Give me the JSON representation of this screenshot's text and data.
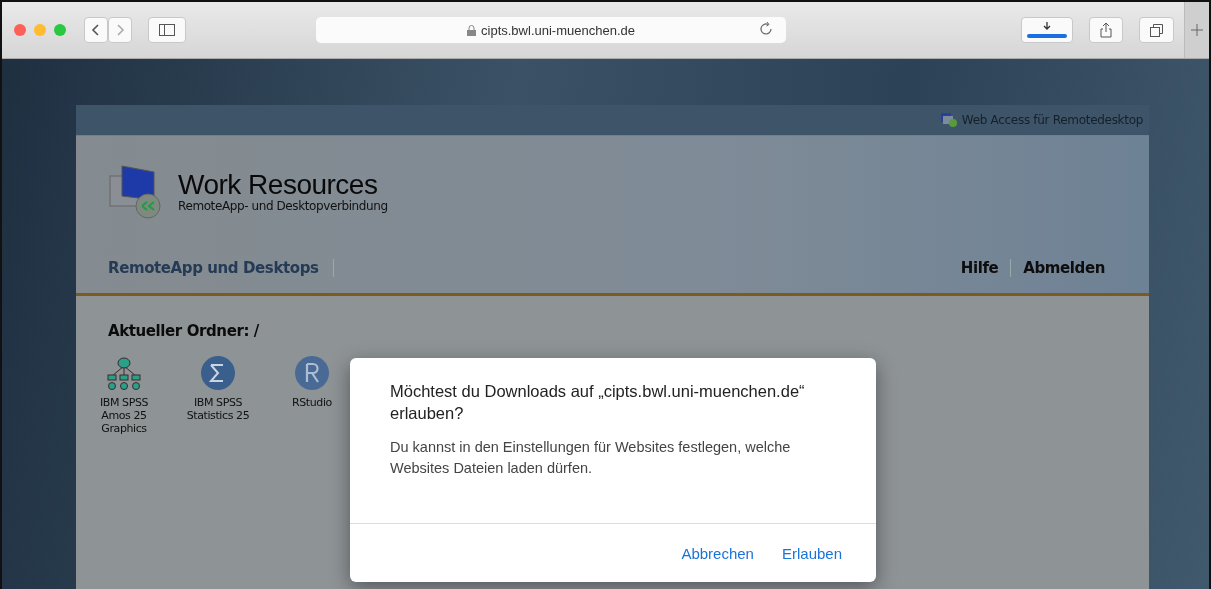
{
  "toolbar": {
    "url": "cipts.bwl.uni-muenchen.de"
  },
  "page": {
    "top_link": "Web Access für Remotedesktop",
    "title": "Work Resources",
    "subtitle": "RemoteApp- und Desktopverbindung",
    "nav_tabs": [
      {
        "label": "RemoteApp und Desktops",
        "selected": true
      }
    ],
    "nav_links": [
      "Hilfe",
      "Abmelden"
    ],
    "folder_label": "Aktueller Ordner: /",
    "apps": [
      {
        "kind": "amos",
        "label": "IBM SPSS Amos 25 Graphics"
      },
      {
        "kind": "spss",
        "label": "IBM SPSS Statistics 25"
      },
      {
        "kind": "r",
        "label": "RStudio"
      }
    ]
  },
  "dialog": {
    "title": "Möchtest du Downloads auf „cipts.bwl.uni-muenchen.de“ erlauben?",
    "message": "Du kannst in den Einstellungen für Websites festlegen, welche Websites Dateien laden dürfen.",
    "buttons": [
      "Abbrechen",
      "Erlauben"
    ]
  }
}
